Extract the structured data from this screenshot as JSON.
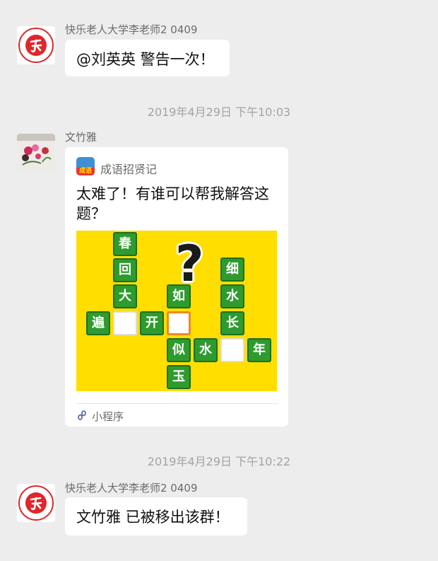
{
  "messages": [
    {
      "sender": "快乐老人大学李老师2  0409",
      "text": "@刘英英 警告一次！"
    },
    {
      "timestamp": "2019年4月29日 下午10:03"
    },
    {
      "sender": "文竹雅",
      "card": {
        "app_name": "成语招贤记",
        "app_icon_text": "成语",
        "title": "太难了！有谁可以帮我解答这题？",
        "footer": "小程序",
        "puzzle": {
          "chars": [
            "春",
            "回",
            "大",
            "遍",
            "开",
            "如",
            "似",
            "水",
            "玉",
            "细",
            "水",
            "长",
            "年"
          ],
          "question_mark": "?"
        }
      }
    },
    {
      "timestamp": "2019年4月29日 下午10:22"
    },
    {
      "sender": "快乐老人大学李老师2  0409",
      "text": "文竹雅 已被移出该群！"
    }
  ],
  "avatars": {
    "teacher": "happy-seniors-university-logo",
    "wenzhuya": "flower-painting-photo"
  },
  "colors": {
    "background": "#ededed",
    "bubble": "#ffffff",
    "logo_red": "#e0262b",
    "tile_green": "#2e9b2e",
    "puzzle_yellow": "#ffde00",
    "highlight_orange": "#f08a1d"
  }
}
